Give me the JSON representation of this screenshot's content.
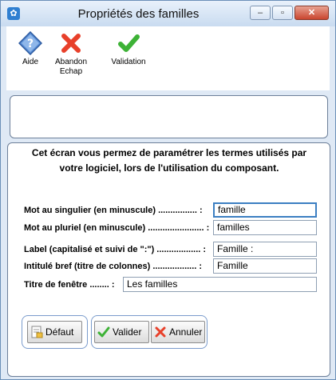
{
  "window": {
    "title": "Propriétés des familles",
    "min_glyph": "–",
    "max_glyph": "▫",
    "close_glyph": "✕"
  },
  "toolbar": {
    "help_label": "Aide",
    "abandon_line1": "Abandon",
    "abandon_line2": "Echap",
    "validation_label": "Validation"
  },
  "intro": {
    "line1": "Cet écran vous permez de paramétrer les termes utilisés par",
    "line2": "votre logiciel, lors de l'utilisation du composant."
  },
  "form": {
    "singular_label": "Mot au singulier (en minuscule) ................ :",
    "singular_value": "famille",
    "plural_label": "Mot au pluriel (en minuscule) ....................... :",
    "plural_value": "familles",
    "label_label": "Label (capitalisé et suivi de \":\") .................. :",
    "label_value": "Famille :",
    "short_label": "Intitulé bref (titre de colonnes) .................. :",
    "short_value": "Famille",
    "window_title_label": "Titre de fenêtre ........ :",
    "window_title_value": "Les familles"
  },
  "buttons": {
    "default_label": "Défaut",
    "validate_label": "Valider",
    "cancel_label": "Annuler"
  },
  "colors": {
    "accent": "#3c7fc2",
    "cancel_red": "#e8402a",
    "valid_green": "#3db236"
  }
}
